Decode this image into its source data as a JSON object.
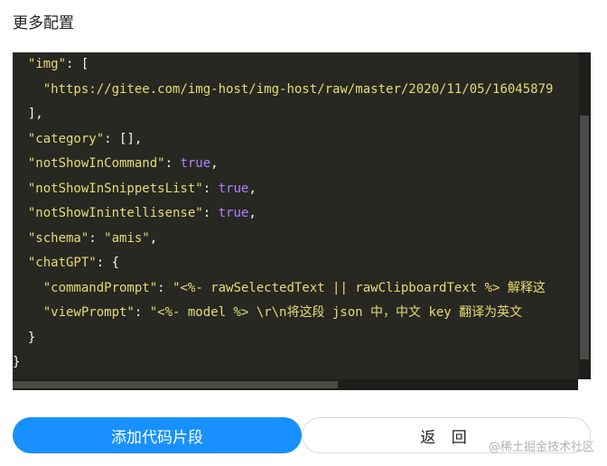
{
  "section_title": "更多配置",
  "editor": {
    "lines": [
      [
        {
          "t": "  "
        },
        {
          "t": "\"img\"",
          "c": "str"
        },
        {
          "t": ": ["
        }
      ],
      [
        {
          "t": "    "
        },
        {
          "t": "\"https://gitee.com/img-host/img-host/raw/master/2020/11/05/16045879",
          "c": "str"
        }
      ],
      [
        {
          "t": "  ],"
        }
      ],
      [
        {
          "t": "  "
        },
        {
          "t": "\"category\"",
          "c": "str"
        },
        {
          "t": ": [],"
        }
      ],
      [
        {
          "t": "  "
        },
        {
          "t": "\"notShowInCommand\"",
          "c": "str"
        },
        {
          "t": ": "
        },
        {
          "t": "true",
          "c": "bool"
        },
        {
          "t": ","
        }
      ],
      [
        {
          "t": "  "
        },
        {
          "t": "\"notShowInSnippetsList\"",
          "c": "str"
        },
        {
          "t": ": "
        },
        {
          "t": "true",
          "c": "bool"
        },
        {
          "t": ","
        }
      ],
      [
        {
          "t": "  "
        },
        {
          "t": "\"notShowInintellisense\"",
          "c": "str"
        },
        {
          "t": ": "
        },
        {
          "t": "true",
          "c": "bool"
        },
        {
          "t": ","
        }
      ],
      [
        {
          "t": "  "
        },
        {
          "t": "\"schema\"",
          "c": "str"
        },
        {
          "t": ": "
        },
        {
          "t": "\"amis\"",
          "c": "str"
        },
        {
          "t": ","
        }
      ],
      [
        {
          "t": "  "
        },
        {
          "t": "\"chatGPT\"",
          "c": "str"
        },
        {
          "t": ": {"
        }
      ],
      [
        {
          "t": "    "
        },
        {
          "t": "\"commandPrompt\"",
          "c": "str"
        },
        {
          "t": ": "
        },
        {
          "t": "\"<%- rawSelectedText || rawClipboardText %> 解释这",
          "c": "str"
        }
      ],
      [
        {
          "t": "    "
        },
        {
          "t": "\"viewPrompt\"",
          "c": "str"
        },
        {
          "t": ": "
        },
        {
          "t": "\"<%- model %> \\r\\n将这段 json 中，中文 key 翻译为英文",
          "c": "str"
        }
      ],
      [
        {
          "t": "  }"
        }
      ],
      [
        {
          "t": "}"
        }
      ]
    ]
  },
  "buttons": {
    "add_label": "添加代码片段",
    "back_label": "返 回"
  },
  "watermark": "@稀土掘金技术社区",
  "colors": {
    "editor_bg": "#272822",
    "string": "#e6db74",
    "boolean": "#ae81ff",
    "primary": "#1890ff"
  }
}
